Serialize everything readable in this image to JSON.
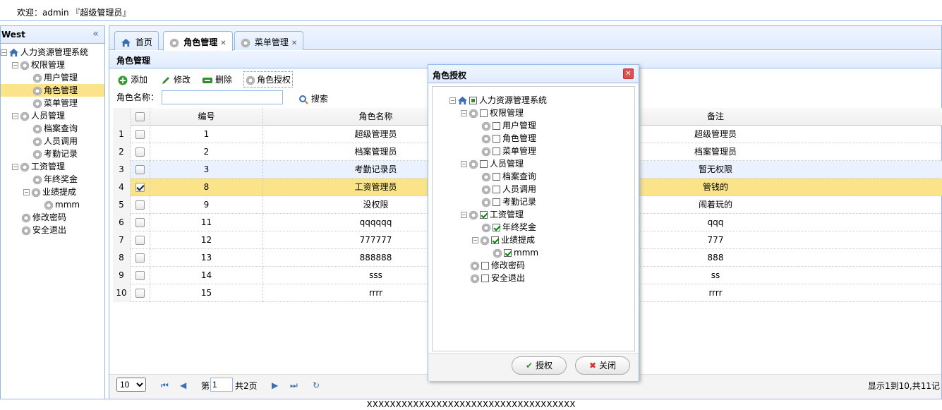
{
  "header": {
    "welcome": "欢迎：admin 『超级管理员』"
  },
  "west": {
    "title": "West",
    "collapse_icon": "«"
  },
  "menu": [
    {
      "label": "人力资源管理系统",
      "icon": "home-icon",
      "level": 0,
      "toggle": "⊟"
    },
    {
      "label": "权限管理",
      "icon": "gear-icon",
      "level": 1,
      "toggle": "⊟"
    },
    {
      "label": "用户管理",
      "icon": "gear-icon",
      "level": 2
    },
    {
      "label": "角色管理",
      "icon": "gear-icon",
      "level": 2,
      "selected": true
    },
    {
      "label": "菜单管理",
      "icon": "gear-icon",
      "level": 2
    },
    {
      "label": "人员管理",
      "icon": "gear-icon",
      "level": 1,
      "toggle": "⊟"
    },
    {
      "label": "档案查询",
      "icon": "gear-icon",
      "level": 2
    },
    {
      "label": "人员调用",
      "icon": "gear-icon",
      "level": 2
    },
    {
      "label": "考勤记录",
      "icon": "gear-icon",
      "level": 2
    },
    {
      "label": "工资管理",
      "icon": "gear-icon",
      "level": 1,
      "toggle": "⊟"
    },
    {
      "label": "年终奖金",
      "icon": "gear-icon",
      "level": 2
    },
    {
      "label": "业绩提成",
      "icon": "gear-icon",
      "level": 2,
      "toggle": "⊟"
    },
    {
      "label": "mmm",
      "icon": "gear-icon",
      "level": 3
    },
    {
      "label": "修改密码",
      "icon": "gear-icon",
      "level": 1
    },
    {
      "label": "安全退出",
      "icon": "gear-icon",
      "level": 1
    }
  ],
  "tabs": [
    {
      "label": "首页",
      "icon": "home-icon"
    },
    {
      "label": "角色管理",
      "icon": "gear-icon",
      "closable": true,
      "active": true
    },
    {
      "label": "菜单管理",
      "icon": "gear-icon",
      "closable": true
    }
  ],
  "panel": {
    "title": "角色管理"
  },
  "toolbar": {
    "add": "添加",
    "edit": "修改",
    "delete": "删除",
    "grant": "角色授权"
  },
  "search": {
    "label": "角色名称：",
    "value": "",
    "button": "搜索"
  },
  "grid": {
    "headers": [
      "编号",
      "角色名称",
      "备注"
    ],
    "rows": [
      {
        "n": "1",
        "id": "1",
        "name": "超级管理员",
        "note": "超级管理员",
        "checked": false
      },
      {
        "n": "2",
        "id": "2",
        "name": "档案管理员",
        "note": "档案管理员",
        "checked": false
      },
      {
        "n": "3",
        "id": "3",
        "name": "考勤记录员",
        "note": "暂无权限",
        "checked": false
      },
      {
        "n": "4",
        "id": "8",
        "name": "工资管理员",
        "note": "管钱的",
        "checked": true
      },
      {
        "n": "5",
        "id": "9",
        "name": "没权限",
        "note": "闹着玩的",
        "checked": false
      },
      {
        "n": "6",
        "id": "11",
        "name": "qqqqqq",
        "note": "qqq",
        "checked": false
      },
      {
        "n": "7",
        "id": "12",
        "name": "777777",
        "note": "777",
        "checked": false
      },
      {
        "n": "8",
        "id": "13",
        "name": "888888",
        "note": "888",
        "checked": false
      },
      {
        "n": "9",
        "id": "14",
        "name": "sss",
        "note": "ss",
        "checked": false
      },
      {
        "n": "10",
        "id": "15",
        "name": "rrrr",
        "note": "rrrr",
        "checked": false
      }
    ]
  },
  "pager": {
    "page_size": "10",
    "page_prefix": "第",
    "page": "1",
    "page_total": "共2页",
    "summary": "显示1到10,共11记"
  },
  "dialog": {
    "title": "角色授权",
    "grant_button": "授权",
    "close_button": "关闭",
    "tree": [
      {
        "label": "人力资源管理系统",
        "level": 0,
        "state": "part",
        "toggle": "⊟",
        "icon": "home-icon"
      },
      {
        "label": "权限管理",
        "level": 1,
        "state": "off",
        "toggle": "⊟"
      },
      {
        "label": "用户管理",
        "level": 2,
        "state": "off"
      },
      {
        "label": "角色管理",
        "level": 2,
        "state": "off"
      },
      {
        "label": "菜单管理",
        "level": 2,
        "state": "off"
      },
      {
        "label": "人员管理",
        "level": 1,
        "state": "off",
        "toggle": "⊟"
      },
      {
        "label": "档案查询",
        "level": 2,
        "state": "off"
      },
      {
        "label": "人员调用",
        "level": 2,
        "state": "off"
      },
      {
        "label": "考勤记录",
        "level": 2,
        "state": "off"
      },
      {
        "label": "工资管理",
        "level": 1,
        "state": "on",
        "toggle": "⊟"
      },
      {
        "label": "年终奖金",
        "level": 2,
        "state": "on"
      },
      {
        "label": "业绩提成",
        "level": 2,
        "state": "on",
        "toggle": "⊟"
      },
      {
        "label": "mmm",
        "level": 3,
        "state": "on"
      },
      {
        "label": "修改密码",
        "level": 1,
        "state": "off"
      },
      {
        "label": "安全退出",
        "level": 1,
        "state": "off"
      }
    ]
  },
  "footer": {
    "text": "XXXXXXXXXXXXXXXXXXXXXXXXXXXXXXXXXXXX"
  }
}
